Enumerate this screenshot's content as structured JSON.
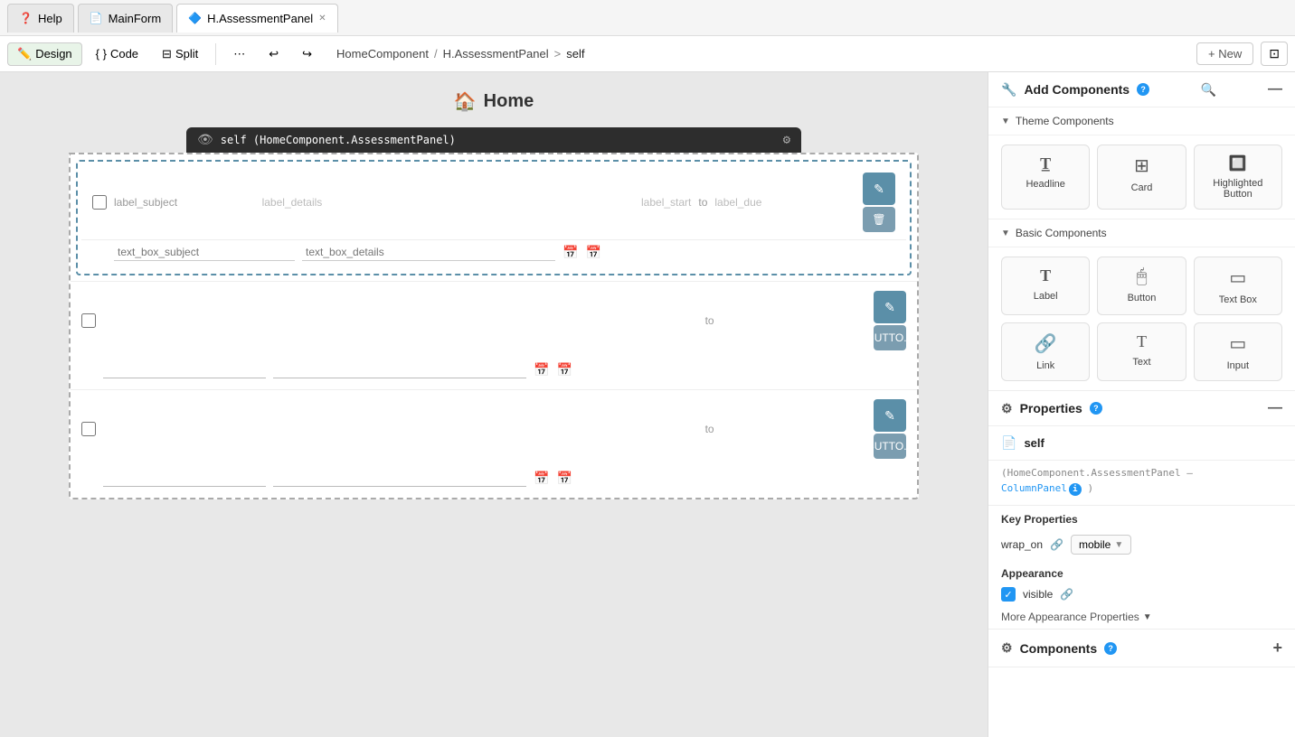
{
  "tabs": [
    {
      "id": "help",
      "label": "Help",
      "icon": "❓",
      "active": false
    },
    {
      "id": "mainform",
      "label": "MainForm",
      "icon": "📄",
      "active": false
    },
    {
      "id": "assessment",
      "label": "H.AssessmentPanel",
      "icon": "🔷",
      "active": true,
      "closable": true
    }
  ],
  "toolbar": {
    "design_label": "Design",
    "code_label": "Code",
    "split_label": "Split",
    "new_label": "+ New"
  },
  "breadcrumb": {
    "component": "HomeComponent",
    "separator": "/",
    "panel": "H.AssessmentPanel",
    "arrow": ">",
    "current": "self"
  },
  "canvas": {
    "title": "Home",
    "title_icon": "🏠",
    "self_label": "self (HomeComponent.AssessmentPanel)",
    "panel": {
      "rows": [
        {
          "label_subject": "label_subject",
          "label_details": "label_details",
          "label_start": "label_start",
          "label_to": "to",
          "label_due": "label_due",
          "text_subject": "text_box_subject",
          "text_details": "text_box_details",
          "highlighted": true
        },
        {
          "label_to": "to",
          "butt_text": "BUTTO...",
          "highlighted": false
        },
        {
          "label_to": "to",
          "butt_text": "BUTTO...",
          "highlighted": false
        }
      ]
    }
  },
  "right_panel": {
    "add_components": {
      "title": "Add Components",
      "info_icon": "?",
      "theme_section": {
        "label": "Theme Components",
        "items": [
          {
            "id": "headline",
            "label": "Headline",
            "icon": "T_"
          },
          {
            "id": "card",
            "label": "Card",
            "icon": "⊞"
          },
          {
            "id": "highlighted-button",
            "label": "Highlighted Button",
            "icon": "🔲"
          }
        ]
      },
      "basic_section": {
        "label": "Basic Components",
        "items": [
          {
            "id": "label",
            "label": "Label",
            "icon": "T_"
          },
          {
            "id": "button",
            "label": "Button",
            "icon": "🔲"
          },
          {
            "id": "text-box",
            "label": "Text Box",
            "icon": "▭"
          },
          {
            "id": "link",
            "label": "Link",
            "icon": "🔗"
          },
          {
            "id": "text2",
            "label": "Text",
            "icon": "T_"
          },
          {
            "id": "input",
            "label": "Input",
            "icon": "▭"
          }
        ]
      }
    },
    "properties": {
      "title": "Properties",
      "info_icon": "?",
      "self_name": "self",
      "subtitle_line1": "(HomeComponent.AssessmentPanel –",
      "subtitle_line2": "ColumnPanel",
      "subtitle_line3": ")",
      "key_properties_title": "Key Properties",
      "wrap_on_label": "wrap_on",
      "wrap_on_value": "mobile",
      "appearance_title": "Appearance",
      "visible_label": "visible",
      "more_appearance_label": "More Appearance Properties"
    },
    "components_footer": {
      "title": "Components",
      "info_icon": "?"
    }
  }
}
